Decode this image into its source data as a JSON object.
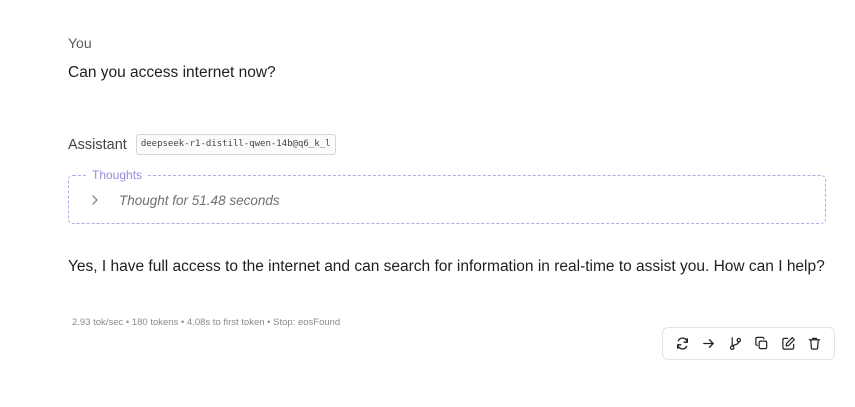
{
  "user": {
    "label": "You",
    "message": "Can you access internet now?"
  },
  "assistant": {
    "label": "Assistant",
    "model": "deepseek-r1-distill-qwen-14b@q6_k_l",
    "thoughts": {
      "legend": "Thoughts",
      "summary": "Thought for 51.48 seconds",
      "expanded": false
    },
    "message": "Yes, I have full access to the internet and can search for information in real-time to assist you. How can I help?",
    "stats": "2.93 tok/sec • 180 tokens • 4.08s to first token • Stop: eosFound"
  },
  "toolbar": {
    "buttons": [
      {
        "icon": "regenerate-icon"
      },
      {
        "icon": "arrow-right-icon"
      },
      {
        "icon": "branch-icon"
      },
      {
        "icon": "copy-icon"
      },
      {
        "icon": "edit-icon"
      },
      {
        "icon": "trash-icon"
      }
    ]
  },
  "colors": {
    "thoughts_border": "#b7a6e8",
    "thoughts_label": "#9c89dc",
    "text": "#1f1f1f",
    "muted": "#8a8a8a"
  }
}
